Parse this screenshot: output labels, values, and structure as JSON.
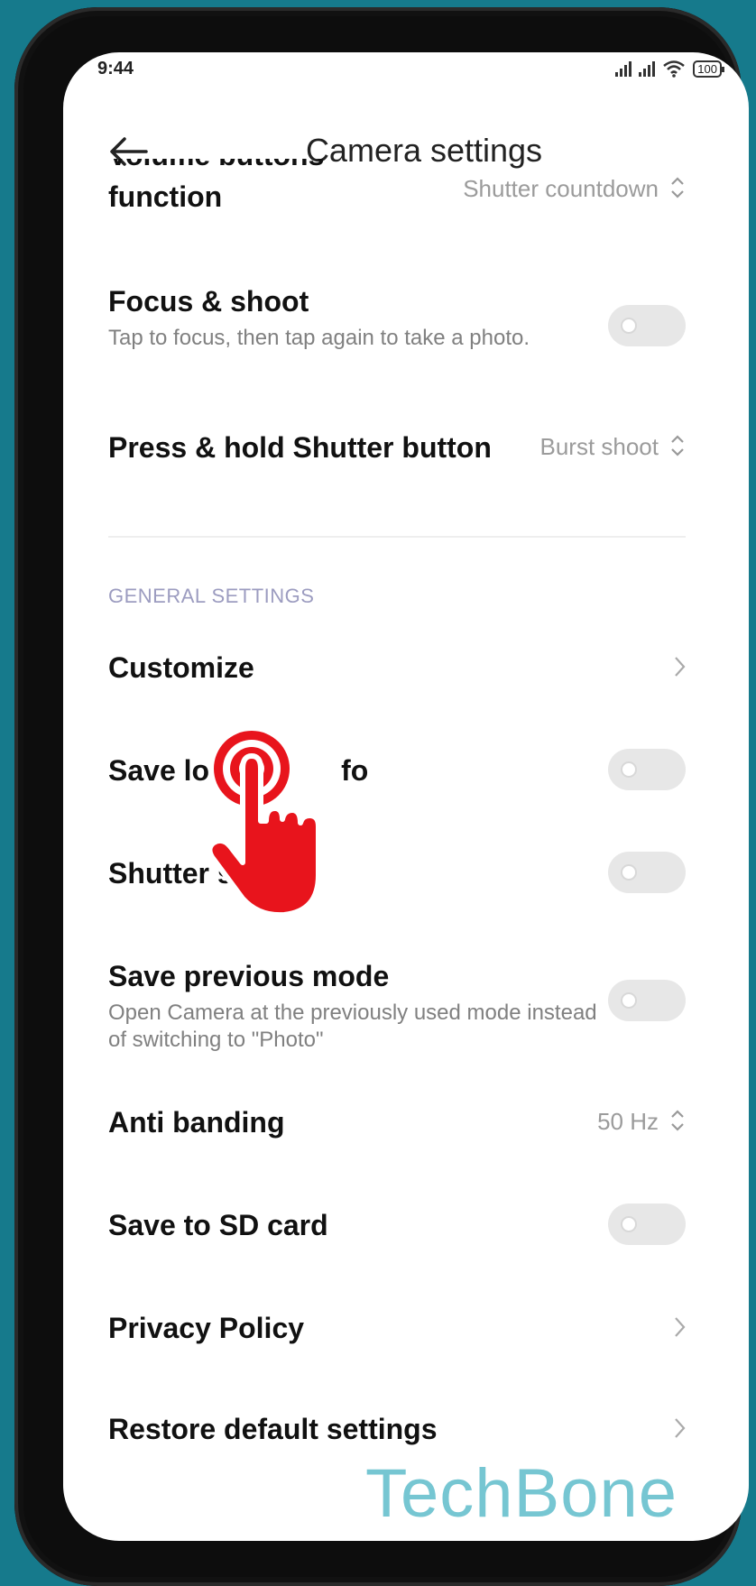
{
  "status_bar": {
    "time": "9:44",
    "battery": "100"
  },
  "header": {
    "title": "Camera settings"
  },
  "settings": {
    "volume": {
      "label_partial": "Volume buttons",
      "label": "function",
      "value": "Shutter countdown"
    },
    "focus_shoot": {
      "label": "Focus & shoot",
      "desc": "Tap to focus, then tap again to take a photo.",
      "enabled": false
    },
    "press_hold": {
      "label": "Press & hold Shutter button",
      "value": "Burst shoot"
    },
    "section_general": "GENERAL SETTINGS",
    "customize": {
      "label": "Customize"
    },
    "save_location": {
      "label_visible_left": "Save lo",
      "label_visible_right": "fo",
      "enabled": false
    },
    "shutter_sound": {
      "label": "Shutter sound",
      "enabled": false
    },
    "save_prev_mode": {
      "label": "Save previous mode",
      "desc": "Open Camera at the previously used mode instead of switching to \"Photo\"",
      "enabled": false
    },
    "anti_banding": {
      "label": "Anti banding",
      "value": "50 Hz"
    },
    "save_sd": {
      "label": "Save to SD card",
      "enabled": false
    },
    "privacy": {
      "label": "Privacy Policy"
    },
    "restore": {
      "label": "Restore default settings"
    }
  },
  "watermark": "TechBone",
  "colors": {
    "background": "#167a8c",
    "accent_hand": "#e8141c",
    "watermark": "#6fc3d0",
    "section": "#9c9cc0"
  }
}
